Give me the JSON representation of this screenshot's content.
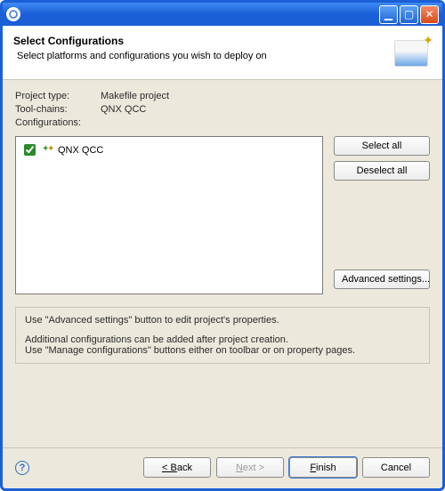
{
  "titlebar": {
    "minimize_glyph": "▁",
    "maximize_glyph": "▢",
    "close_glyph": "✕"
  },
  "header": {
    "title": "Select Configurations",
    "subtitle": "Select platforms and configurations you wish to deploy on"
  },
  "info": {
    "project_type_label": "Project type:",
    "project_type_value": "Makefile project",
    "toolchains_label": "Tool-chains:",
    "toolchains_value": "QNX QCC",
    "configs_label": "Configurations:"
  },
  "configs": [
    {
      "checked": true,
      "label": "QNX QCC"
    }
  ],
  "side": {
    "select_all": "Select all",
    "deselect_all": "Deselect all",
    "advanced": "Advanced settings..."
  },
  "hint": {
    "line1": "Use \"Advanced settings\" button to edit project's properties.",
    "line2": "Additional configurations can be added after project creation.",
    "line3": "Use \"Manage configurations\" buttons either on toolbar or on property pages."
  },
  "footer": {
    "back": "< Back",
    "next": "Next >",
    "finish": "Finish",
    "cancel": "Cancel"
  }
}
